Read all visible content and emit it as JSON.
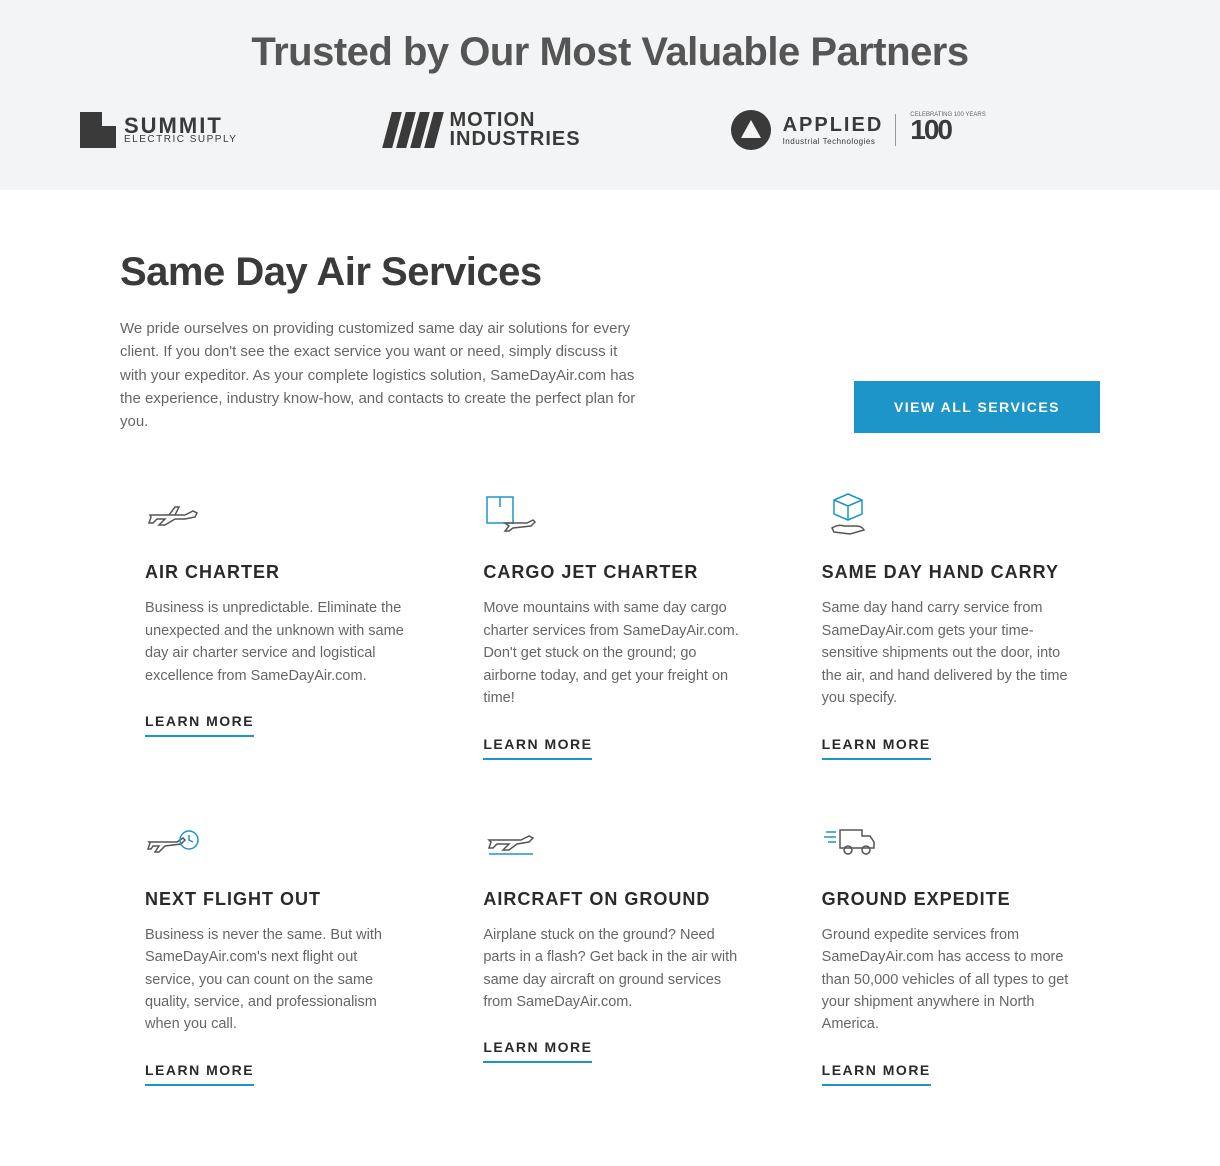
{
  "partners": {
    "heading": "Trusted by Our Most Valuable Partners",
    "logos": {
      "summit": {
        "name": "SUMMIT",
        "sub": "ELECTRIC SUPPLY"
      },
      "motion": {
        "l1": "MOTION",
        "l2": "INDUSTRIES"
      },
      "applied": {
        "name": "APPLIED",
        "sub": "Industrial Technologies",
        "badge_num": "100",
        "badge_sub": "CELEBRATING 100 YEARS"
      }
    }
  },
  "services": {
    "title": "Same Day Air Services",
    "description": "We pride ourselves on providing customized same day air solutions for every client. If you don't see the exact service you want or need, simply discuss it with your expeditor. As your complete logistics solution, SameDayAir.com has the experience, industry know-how, and contacts to create the perfect plan for you.",
    "view_all_label": "VIEW ALL SERVICES",
    "learn_more_label": "LEARN MORE",
    "items": [
      {
        "title": "AIR CHARTER",
        "desc": "Business is unpredictable. Eliminate the unexpected and the unknown with same day air charter service and logistical excellence from SameDayAir.com."
      },
      {
        "title": "CARGO JET CHARTER",
        "desc": "Move mountains with same day cargo charter services from SameDayAir.com. Don't get stuck on the ground; go airborne today, and get your freight on time!"
      },
      {
        "title": "SAME DAY HAND CARRY",
        "desc": "Same day hand carry service from SameDayAir.com gets your time-sensitive shipments out the door, into the air, and hand delivered by the time you specify."
      },
      {
        "title": "NEXT FLIGHT OUT",
        "desc": "Business is never the same. But with SameDayAir.com's next flight out service, you can count on the same quality, service, and professionalism when you call."
      },
      {
        "title": "AIRCRAFT ON GROUND",
        "desc": "Airplane stuck on the ground? Need parts in a flash? Get back in the air with same day aircraft on ground services from SameDayAir.com."
      },
      {
        "title": "GROUND EXPEDITE",
        "desc": "Ground expedite services from SameDayAir.com has access to more than 50,000 vehicles of all types to get your shipment anywhere in North America."
      }
    ]
  }
}
